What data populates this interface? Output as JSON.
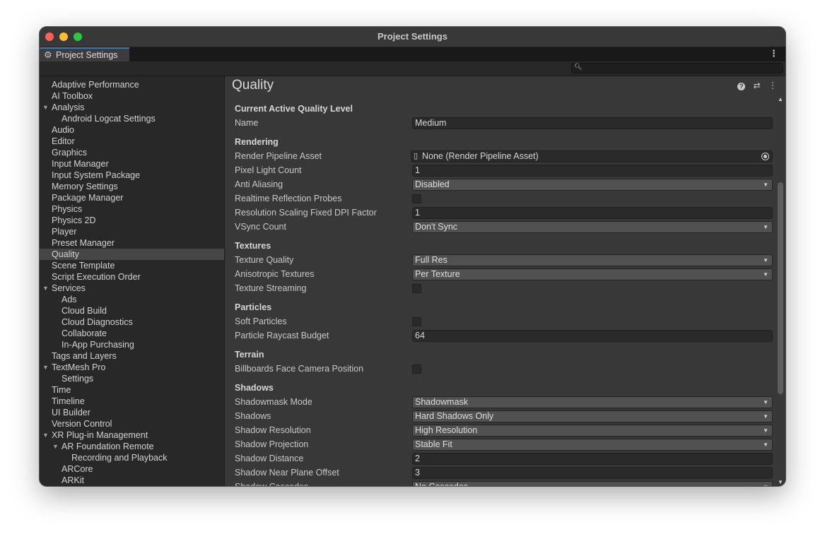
{
  "window": {
    "title": "Project Settings"
  },
  "tab": {
    "label": "Project Settings",
    "menu_icon": "⋮"
  },
  "search": {
    "placeholder": "",
    "value": ""
  },
  "sidebar": {
    "items": [
      {
        "label": "Adaptive Performance",
        "level": 0
      },
      {
        "label": "AI Toolbox",
        "level": 0
      },
      {
        "label": "Analysis",
        "level": 0,
        "expanded": true
      },
      {
        "label": "Android Logcat Settings",
        "level": 1
      },
      {
        "label": "Audio",
        "level": 0
      },
      {
        "label": "Editor",
        "level": 0
      },
      {
        "label": "Graphics",
        "level": 0
      },
      {
        "label": "Input Manager",
        "level": 0
      },
      {
        "label": "Input System Package",
        "level": 0
      },
      {
        "label": "Memory Settings",
        "level": 0
      },
      {
        "label": "Package Manager",
        "level": 0
      },
      {
        "label": "Physics",
        "level": 0
      },
      {
        "label": "Physics 2D",
        "level": 0
      },
      {
        "label": "Player",
        "level": 0
      },
      {
        "label": "Preset Manager",
        "level": 0
      },
      {
        "label": "Quality",
        "level": 0,
        "selected": true
      },
      {
        "label": "Scene Template",
        "level": 0
      },
      {
        "label": "Script Execution Order",
        "level": 0
      },
      {
        "label": "Services",
        "level": 0,
        "expanded": true
      },
      {
        "label": "Ads",
        "level": 1
      },
      {
        "label": "Cloud Build",
        "level": 1
      },
      {
        "label": "Cloud Diagnostics",
        "level": 1
      },
      {
        "label": "Collaborate",
        "level": 1
      },
      {
        "label": "In-App Purchasing",
        "level": 1
      },
      {
        "label": "Tags and Layers",
        "level": 0
      },
      {
        "label": "TextMesh Pro",
        "level": 0,
        "expanded": true
      },
      {
        "label": "Settings",
        "level": 1
      },
      {
        "label": "Time",
        "level": 0
      },
      {
        "label": "Timeline",
        "level": 0
      },
      {
        "label": "UI Builder",
        "level": 0
      },
      {
        "label": "Version Control",
        "level": 0
      },
      {
        "label": "XR Plug-in Management",
        "level": 0,
        "expanded": true
      },
      {
        "label": "AR Foundation Remote",
        "level": 1,
        "expanded": true
      },
      {
        "label": "Recording and Playback",
        "level": 2
      },
      {
        "label": "ARCore",
        "level": 1
      },
      {
        "label": "ARKit",
        "level": 1
      }
    ]
  },
  "main": {
    "title": "Quality",
    "sections": [
      {
        "title": "Current Active Quality Level",
        "rows": [
          {
            "label": "Name",
            "type": "text",
            "value": "Medium"
          }
        ]
      },
      {
        "title": "Rendering",
        "rows": [
          {
            "label": "Render Pipeline Asset",
            "type": "object",
            "value": "None (Render Pipeline Asset)"
          },
          {
            "label": "Pixel Light Count",
            "type": "text",
            "value": "1"
          },
          {
            "label": "Anti Aliasing",
            "type": "dropdown",
            "value": "Disabled"
          },
          {
            "label": "Realtime Reflection Probes",
            "type": "checkbox",
            "value": false
          },
          {
            "label": "Resolution Scaling Fixed DPI Factor",
            "type": "text",
            "value": "1"
          },
          {
            "label": "VSync Count",
            "type": "dropdown",
            "value": "Don't Sync"
          }
        ]
      },
      {
        "title": "Textures",
        "rows": [
          {
            "label": "Texture Quality",
            "type": "dropdown",
            "value": "Full Res"
          },
          {
            "label": "Anisotropic Textures",
            "type": "dropdown",
            "value": "Per Texture"
          },
          {
            "label": "Texture Streaming",
            "type": "checkbox",
            "value": false
          }
        ]
      },
      {
        "title": "Particles",
        "rows": [
          {
            "label": "Soft Particles",
            "type": "checkbox",
            "value": false
          },
          {
            "label": "Particle Raycast Budget",
            "type": "text",
            "value": "64"
          }
        ]
      },
      {
        "title": "Terrain",
        "rows": [
          {
            "label": "Billboards Face Camera Position",
            "type": "checkbox",
            "value": false
          }
        ]
      },
      {
        "title": "Shadows",
        "rows": [
          {
            "label": "Shadowmask Mode",
            "type": "dropdown",
            "value": "Shadowmask"
          },
          {
            "label": "Shadows",
            "type": "dropdown",
            "value": "Hard Shadows Only"
          },
          {
            "label": "Shadow Resolution",
            "type": "dropdown",
            "value": "High Resolution"
          },
          {
            "label": "Shadow Projection",
            "type": "dropdown",
            "value": "Stable Fit"
          },
          {
            "label": "Shadow Distance",
            "type": "text",
            "value": "2"
          },
          {
            "label": "Shadow Near Plane Offset",
            "type": "text",
            "value": "3"
          },
          {
            "label": "Shadow Cascades",
            "type": "dropdown",
            "value": "No Cascades"
          }
        ]
      }
    ]
  },
  "colors": {
    "window_bg": "#282828",
    "panel_bg": "#383838",
    "selected_bg": "#464646",
    "tab_accent": "#3a79bb"
  }
}
